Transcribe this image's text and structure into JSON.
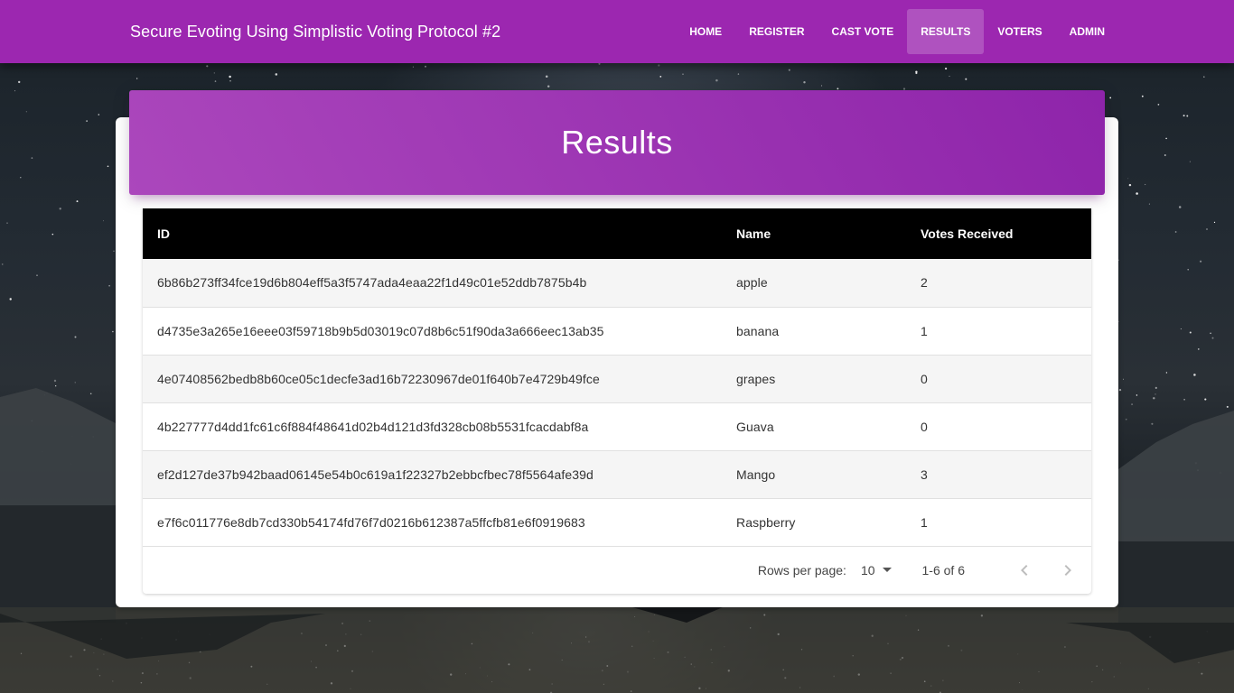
{
  "navbar": {
    "brand": "Secure Evoting Using Simplistic Voting Protocol #2",
    "links": [
      {
        "label": "HOME",
        "active": false
      },
      {
        "label": "REGISTER",
        "active": false
      },
      {
        "label": "CAST VOTE",
        "active": false
      },
      {
        "label": "RESULTS",
        "active": true
      },
      {
        "label": "VOTERS",
        "active": false
      },
      {
        "label": "ADMIN",
        "active": false
      }
    ],
    "color": "#9c27b0"
  },
  "card": {
    "title": "Results"
  },
  "table": {
    "headers": [
      "ID",
      "Name",
      "Votes Received"
    ],
    "rows": [
      {
        "id": "6b86b273ff34fce19d6b804eff5a3f5747ada4eaa22f1d49c01e52ddb7875b4b",
        "name": "apple",
        "votes": "2"
      },
      {
        "id": "d4735e3a265e16eee03f59718b9b5d03019c07d8b6c51f90da3a666eec13ab35",
        "name": "banana",
        "votes": "1"
      },
      {
        "id": "4e07408562bedb8b60ce05c1decfe3ad16b72230967de01f640b7e4729b49fce",
        "name": "grapes",
        "votes": "0"
      },
      {
        "id": "4b227777d4dd1fc61c6f884f48641d02b4d121d3fd328cb08b5531fcacdabf8a",
        "name": "Guava",
        "votes": "0"
      },
      {
        "id": "ef2d127de37b942baad06145e54b0c619a1f22327b2ebbcfbec78f5564afe39d",
        "name": "Mango",
        "votes": "3"
      },
      {
        "id": "e7f6c011776e8db7cd330b54174fd76f7d0216b612387a5ffcfb81e6f0919683",
        "name": "Raspberry",
        "votes": "1"
      }
    ]
  },
  "pagination": {
    "rows_per_page_label": "Rows per page:",
    "rows_per_page_value": "10",
    "range_text": "1-6 of 6",
    "prev_icon": "chevron-left-icon",
    "next_icon": "chevron-right-icon"
  }
}
